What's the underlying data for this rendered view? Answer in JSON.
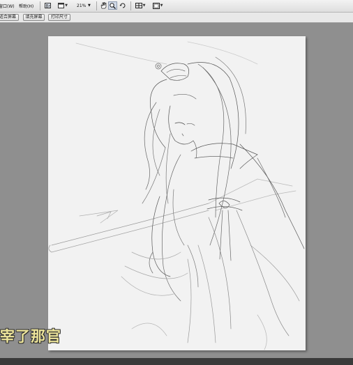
{
  "menubar": {
    "items": [
      "窗口(W)",
      "帮助(H)"
    ],
    "zoom": "21%",
    "icons": [
      "bridge-icon",
      "screen-mode-icon",
      "hand-tool-icon",
      "zoom-tool-icon",
      "rotate-view-icon",
      "arrange-documents-icon",
      "workspace-icon"
    ]
  },
  "options_bar": {
    "buttons": [
      "适合屏幕",
      "填充屏幕",
      "打印尺寸"
    ]
  },
  "caption": {
    "text": "宰了那官",
    "color": "#ece49a"
  }
}
